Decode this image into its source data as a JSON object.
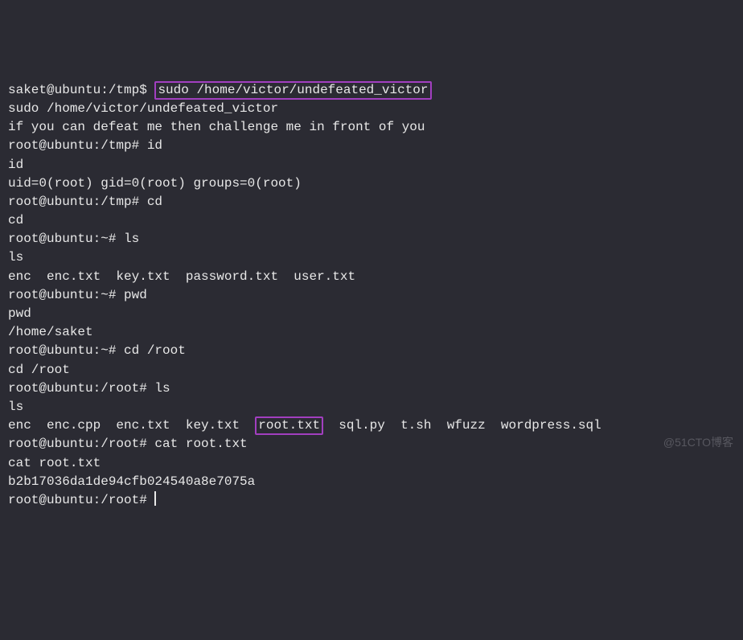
{
  "lines": [
    {
      "segments": [
        {
          "text": "saket@ubuntu:/tmp$ "
        },
        {
          "text": "sudo /home/victor/undefeated_victor",
          "hl": true
        }
      ]
    },
    {
      "segments": [
        {
          "text": "sudo /home/victor/undefeated_victor"
        }
      ]
    },
    {
      "segments": [
        {
          "text": "if you can defeat me then challenge me in front of you"
        }
      ]
    },
    {
      "segments": [
        {
          "text": "root@ubuntu:/tmp# id"
        }
      ]
    },
    {
      "segments": [
        {
          "text": "id"
        }
      ]
    },
    {
      "segments": [
        {
          "text": "uid=0(root) gid=0(root) groups=0(root)"
        }
      ]
    },
    {
      "segments": [
        {
          "text": "root@ubuntu:/tmp# cd"
        }
      ]
    },
    {
      "segments": [
        {
          "text": "cd"
        }
      ]
    },
    {
      "segments": [
        {
          "text": "root@ubuntu:~# ls"
        }
      ]
    },
    {
      "segments": [
        {
          "text": "ls"
        }
      ]
    },
    {
      "segments": [
        {
          "text": "enc  enc.txt  key.txt  password.txt  user.txt"
        }
      ]
    },
    {
      "segments": [
        {
          "text": "root@ubuntu:~# pwd"
        }
      ]
    },
    {
      "segments": [
        {
          "text": "pwd"
        }
      ]
    },
    {
      "segments": [
        {
          "text": "/home/saket"
        }
      ]
    },
    {
      "segments": [
        {
          "text": "root@ubuntu:~# cd /root"
        }
      ]
    },
    {
      "segments": [
        {
          "text": "cd /root"
        }
      ]
    },
    {
      "segments": [
        {
          "text": "root@ubuntu:/root# ls"
        }
      ]
    },
    {
      "segments": [
        {
          "text": "ls"
        }
      ]
    },
    {
      "segments": [
        {
          "text": "enc  enc.cpp  enc.txt  key.txt  "
        },
        {
          "text": "root.txt",
          "hl": true
        },
        {
          "text": "  sql.py  t.sh  wfuzz  wordpress.sql"
        }
      ]
    },
    {
      "segments": [
        {
          "text": "root@ubuntu:/root# cat root.txt"
        }
      ]
    },
    {
      "segments": [
        {
          "text": "cat root.txt"
        }
      ]
    },
    {
      "segments": [
        {
          "text": "b2b17036da1de94cfb024540a8e7075a"
        }
      ]
    },
    {
      "segments": [
        {
          "text": "root@ubuntu:/root# "
        }
      ],
      "cursor": true
    }
  ],
  "watermark": "@51CTO博客"
}
